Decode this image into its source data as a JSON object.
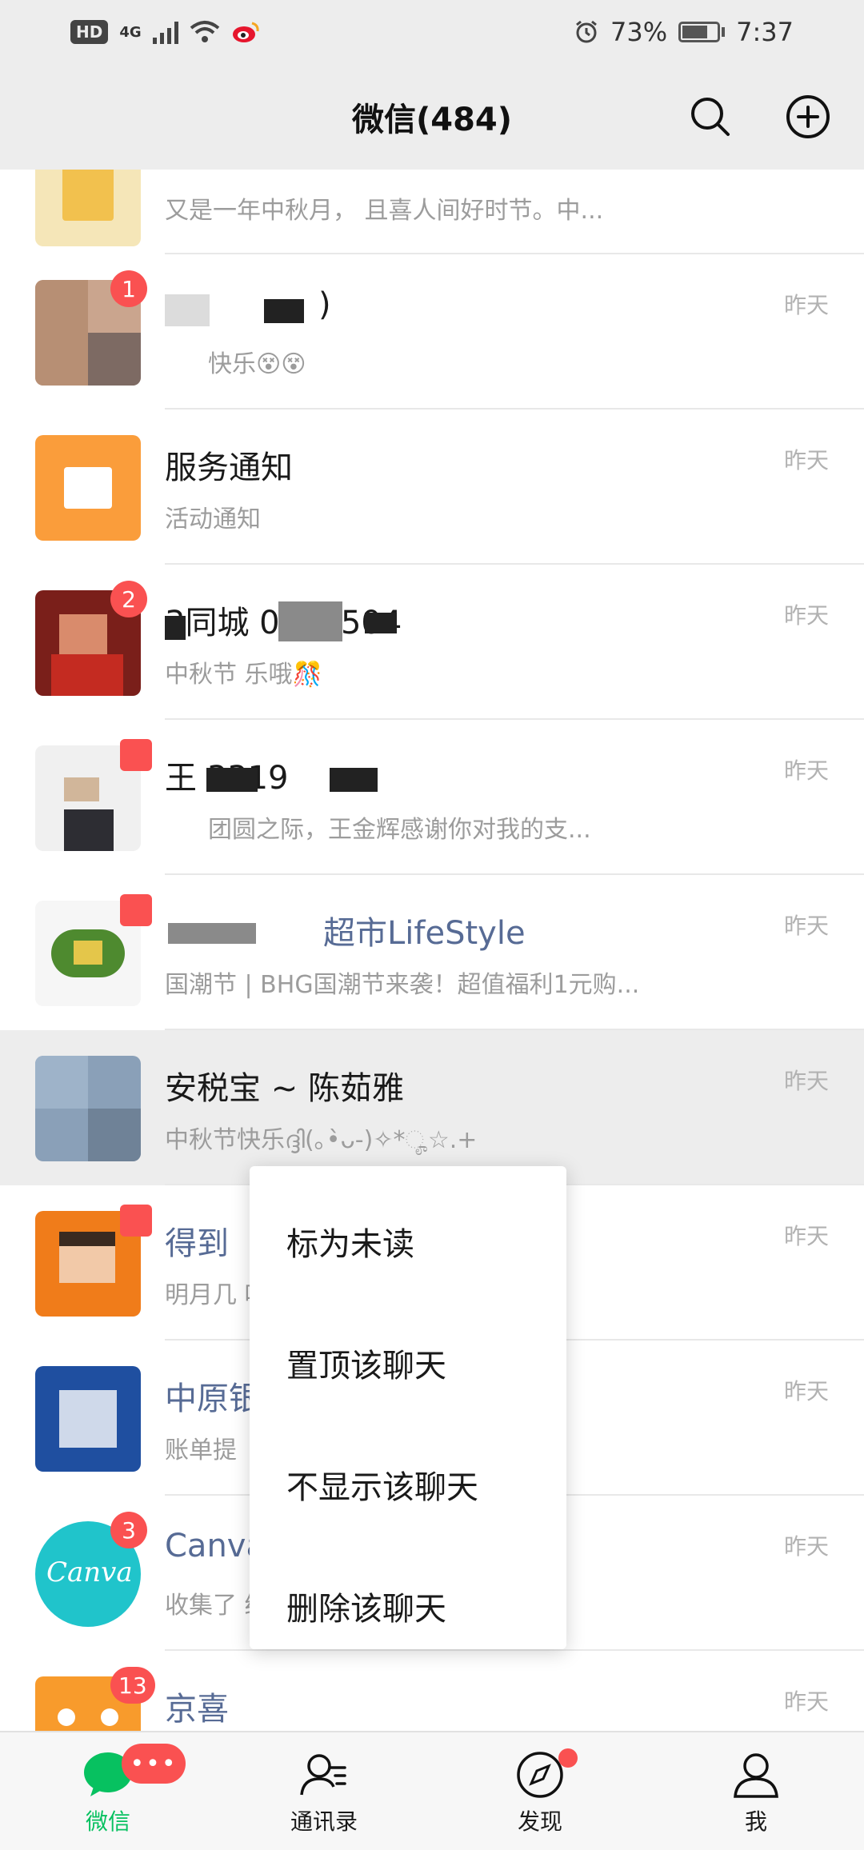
{
  "status_bar": {
    "hd": "HD",
    "network": "4G",
    "battery_text": "73%",
    "battery_level": 0.73,
    "time": "7:37"
  },
  "header": {
    "title": "微信(484)",
    "search_icon": "search-icon",
    "add_icon": "plus-circle-icon"
  },
  "chats": [
    {
      "name": "",
      "preview": "又是一年中秋月， 且喜人间好时节。中...",
      "time": "",
      "badge": ""
    },
    {
      "name": ")",
      "preview": "快乐😵😵",
      "time": "昨天",
      "badge": "1"
    },
    {
      "name": "服务通知",
      "preview": "活动通知",
      "time": "昨天",
      "badge": ""
    },
    {
      "name": "3同城              0708504",
      "preview": "中秋节  乐哦🎊",
      "time": "昨天",
      "badge": "2"
    },
    {
      "name": "王                  3319",
      "preview": "团圆之际，王金辉感谢你对我的支...",
      "time": "昨天",
      "badge": ""
    },
    {
      "name": "超市LifeStyle",
      "preview": "国潮节 | BHG国潮节来袭！超值福利1元购...",
      "time": "昨天",
      "badge": ""
    },
    {
      "name": "安税宝 ~ 陈茹雅",
      "preview": "中秋节快乐ദ്ദി(｡•̀ᴗ-)✧*ೄ☆.+",
      "time": "昨天",
      "badge": ""
    },
    {
      "name": "得到",
      "preview": "明月几                   听罗胖和...",
      "time": "昨天",
      "badge": ""
    },
    {
      "name": "中原银",
      "preview": "账单提",
      "time": "昨天",
      "badge": ""
    },
    {
      "name": "Canva",
      "preview": "收集了                          给你爱的人",
      "time": "昨天",
      "badge": "3"
    },
    {
      "name": "京喜",
      "preview": "",
      "time": "昨天",
      "badge": "13"
    }
  ],
  "context_menu": {
    "items": [
      "标为未读",
      "置顶该聊天",
      "不显示该聊天",
      "删除该聊天"
    ]
  },
  "tab_bar": {
    "tabs": [
      {
        "label": "微信",
        "icon": "chat-bubble-icon",
        "badge": "•••"
      },
      {
        "label": "通讯录",
        "icon": "contacts-icon"
      },
      {
        "label": "发现",
        "icon": "compass-icon"
      },
      {
        "label": "我",
        "icon": "person-icon"
      }
    ]
  },
  "colors": {
    "accent_green": "#07c160",
    "badge_red": "#fa5151",
    "official_blue": "#576b95"
  }
}
